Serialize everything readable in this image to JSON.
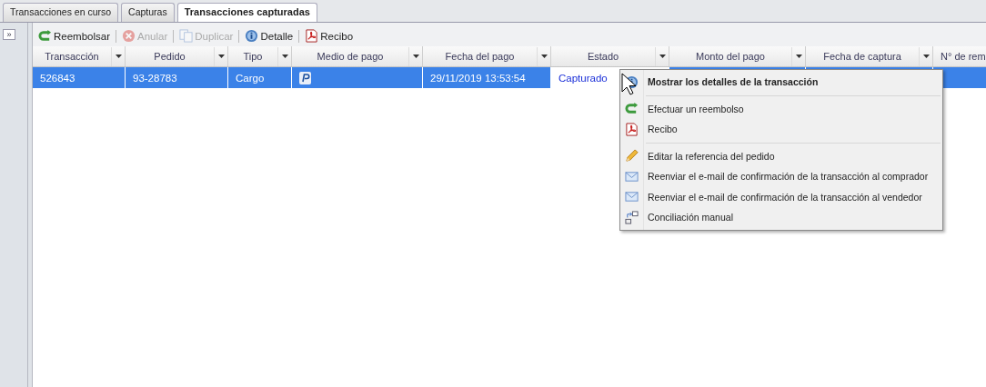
{
  "tabs": [
    {
      "label": "Transacciones en curso",
      "selected": false
    },
    {
      "label": "Capturas",
      "selected": false
    },
    {
      "label": "Transacciones capturadas",
      "selected": true
    }
  ],
  "side_toggle": "»",
  "toolbar": [
    {
      "kind": "refund",
      "label": "Reembolsar",
      "disabled": false
    },
    {
      "kind": "cancel",
      "label": "Anular",
      "disabled": true
    },
    {
      "kind": "duplicate",
      "label": "Duplicar",
      "disabled": true
    },
    {
      "kind": "detail",
      "label": "Detalle",
      "disabled": false
    },
    {
      "kind": "receipt",
      "label": "Recibo",
      "disabled": false
    }
  ],
  "table": {
    "columns": [
      "Transacción",
      "Pedido",
      "Tipo",
      "Medio de pago",
      "Fecha del pago",
      "Estado",
      "Monto del pago",
      "Fecha de captura",
      "N° de rem"
    ],
    "rows": [
      {
        "selected": true,
        "cells": [
          {
            "kind": "text",
            "text": "526843"
          },
          {
            "kind": "text",
            "text": "93-28783"
          },
          {
            "kind": "text",
            "text": "Cargo"
          },
          {
            "kind": "card"
          },
          {
            "kind": "text",
            "text": "29/11/2019 13:53:54"
          },
          {
            "kind": "status",
            "text": "Capturado"
          },
          {
            "kind": "empty"
          },
          {
            "kind": "empty"
          },
          {
            "kind": "empty"
          }
        ]
      }
    ]
  },
  "context_menu": [
    {
      "kind": "detail",
      "label": "Mostrar los detalles de la transacción",
      "default": true
    },
    {
      "kind": "separator"
    },
    {
      "kind": "refund",
      "label": "Efectuar un reembolso",
      "default": false
    },
    {
      "kind": "receipt",
      "label": "Recibo",
      "default": false
    },
    {
      "kind": "separator"
    },
    {
      "kind": "edit",
      "label": "Editar la referencia del pedido",
      "default": false
    },
    {
      "kind": "email",
      "label": "Reenviar el e-mail de confirmación de la transacción al comprador",
      "default": false
    },
    {
      "kind": "email",
      "label": "Reenviar el e-mail de confirmación de la transacción al vendedor",
      "default": false
    },
    {
      "kind": "reconcile",
      "label": "Conciliación manual",
      "default": false
    }
  ]
}
